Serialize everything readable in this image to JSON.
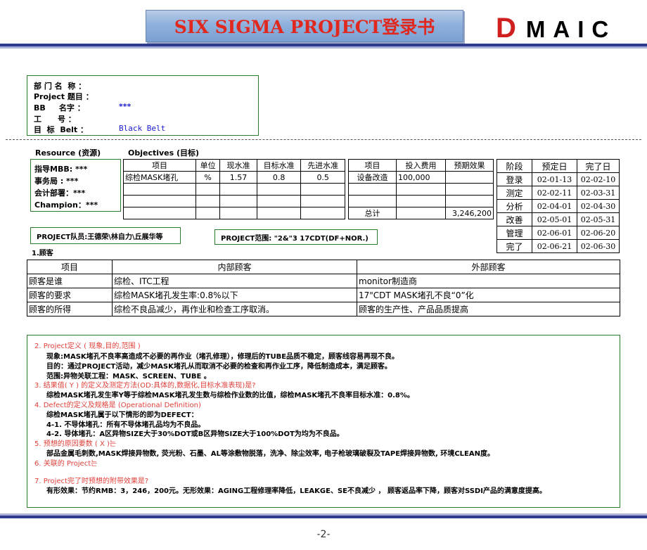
{
  "header": {
    "title": "SIX SIGMA PROJECT登录书",
    "brand_d": "D",
    "brand_rest": "MAIC"
  },
  "info": {
    "dept_label": "部 门 名  称 ：",
    "project_label": "Project 题目 ：",
    "bb_label": "BB     名字 ：",
    "bb_value": "***",
    "id_label": "工      号 ：",
    "goal_label": "目  标  Belt ：",
    "goal_value": "Black Belt"
  },
  "resource": {
    "heading": "Resource (资源)",
    "rows": [
      "指导MBB:  ***",
      "事务局 :  ***",
      "会计部署：***",
      "Champion：***"
    ]
  },
  "objectives": {
    "heading": "Objectives (目标)",
    "headers": [
      "项目",
      "单位",
      "现水准",
      "目标水准",
      "先进水准"
    ],
    "rows": [
      [
        "综检MASK堵孔",
        "%",
        "1.57",
        "0.8",
        "0.5"
      ],
      [
        "",
        "",
        "",
        "",
        ""
      ],
      [
        "",
        "",
        "",
        "",
        ""
      ],
      [
        "",
        "",
        "",
        "",
        ""
      ]
    ]
  },
  "cost": {
    "headers": [
      "项目",
      "投入费用",
      "预期效果"
    ],
    "rows": [
      [
        "设备改造",
        "100,000",
        ""
      ],
      [
        "",
        "",
        ""
      ],
      [
        "",
        "",
        ""
      ],
      [
        "总计",
        "",
        "3,246,200"
      ]
    ]
  },
  "phases": {
    "headers": [
      "阶段",
      "预定日",
      "完了日"
    ],
    "rows": [
      [
        "登录",
        "02-01-13",
        "02-02-10"
      ],
      [
        "测定",
        "02-02-11",
        "02-03-31"
      ],
      [
        "分析",
        "02-04-01",
        "02-04-30"
      ],
      [
        "改善",
        "02-05-01",
        "02-05-31"
      ],
      [
        "管理",
        "02-06-01",
        "02-06-20"
      ],
      [
        "完了",
        "02-06-21",
        "02-06-30"
      ]
    ]
  },
  "team": "PROJECT队员:王德荣\\林自力\\丘展华等",
  "scope": "PROJECT范围: \"2&\"3 17CDT(DF+NOR.)",
  "customer": {
    "section_title": "1.顾客",
    "headers": [
      "项目",
      "内部顾客",
      "外部顾客"
    ],
    "rows": [
      [
        "顾客是谁",
        "综检、ITC工程",
        "monitor制造商"
      ],
      [
        "顾客的要求",
        "综检MASK堵孔发生率:0.8%以下",
        "17\"CDT MASK堵孔不良“0”化"
      ],
      [
        "顾客的所得",
        "综检不良品减少，再作业和检查工序取消。",
        "顾客的生产性、产品品质提高"
      ]
    ]
  },
  "definition": {
    "s2_title": "2. Project定义  ( 现象,目的,范围 )",
    "s2_l1": "现象:MASK堵孔不良率高造成不必要的再作业（堵孔修理），修理后的TUBE品质不稳定，顾客线容易再现不良。",
    "s2_l2": "目的：通过PROJECT活动，减少MASK堵孔从而取消不必要的检查和再作业工序，降低制造成本，满足顾客。",
    "s2_l3": "范围:异物关联工程：MASK、SCREEN、TUBE 。",
    "s3_title": "3. 结果值( Y )  的定义及测定方法(OD:具体的,数据化,目标水准表现)是?",
    "s3_l1": "综检MASK堵孔发生率Y等于综检MASK堵孔发生数与综检作业数的比值，综检MASK堵孔不良率目标水准：0.8%。",
    "s4_title": "4. Defect的定义及规格是 (Operational Definition)",
    "s4_l1": "综检MASK堵孔属于以下情形的即为DEFECT：",
    "s4_l2": "4-1. 不导体堵孔：所有不导体堵孔品均为不良品。",
    "s4_l3": "4-2. 导体堵孔：A区异物SIZE大于30%DOT或B区异物SIZE大于100%DOT为均为不良品。",
    "s5_title": "5. 预想的原因要数 ( X )는",
    "s5_l1": "部品金属毛刺数,MASK焊接异物数, 荧光粉、石墨、AL等涂敷物脱落，洗净、除尘效率, 电子枪玻璃破裂及TAPE焊接异物数, 环境CLEAN度。",
    "s6_title": "6. 关联的 Project는",
    "s7_title": "7. Project完了时预想的附带效果是?",
    "s7_l1": "有形效果：节约RMB：3，246，200元。无形效果：AGING工程修理率降低，LEAKGE、SE不良减少 ， 顾客返品率下降，顾客对SSDI产品的满意度提高。"
  },
  "page_number": "-2-"
}
